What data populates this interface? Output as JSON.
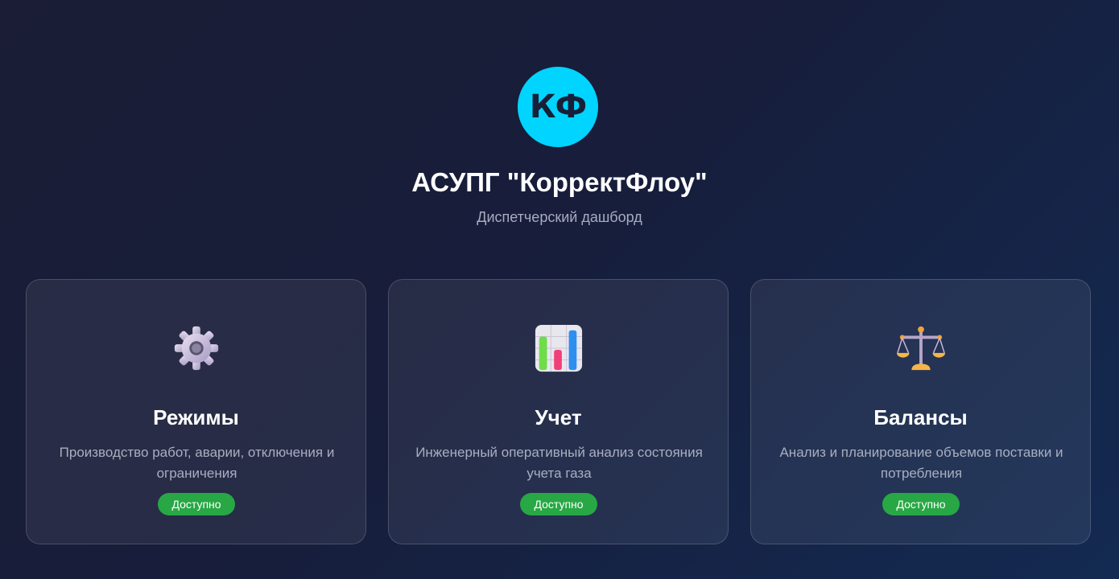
{
  "header": {
    "logo_text": "КФ",
    "title": "АСУПГ \"КорректФлоу\"",
    "subtitle": "Диспетчерский дашборд"
  },
  "cards": [
    {
      "icon": "gear-icon",
      "title": "Режимы",
      "description": "Производство работ, аварии, отключения и ограничения",
      "status": "Доступно"
    },
    {
      "icon": "bar-chart-icon",
      "title": "Учет",
      "description": "Инженерный оперативный анализ состояния учета газа",
      "status": "Доступно"
    },
    {
      "icon": "balance-scale-icon",
      "title": "Балансы",
      "description": "Анализ и планирование объемов поставки и потребления",
      "status": "Доступно"
    }
  ],
  "colors": {
    "accent": "#00d4ff",
    "status_available": "#28a745",
    "background_start": "#1a1d35",
    "background_end": "#132a52"
  }
}
